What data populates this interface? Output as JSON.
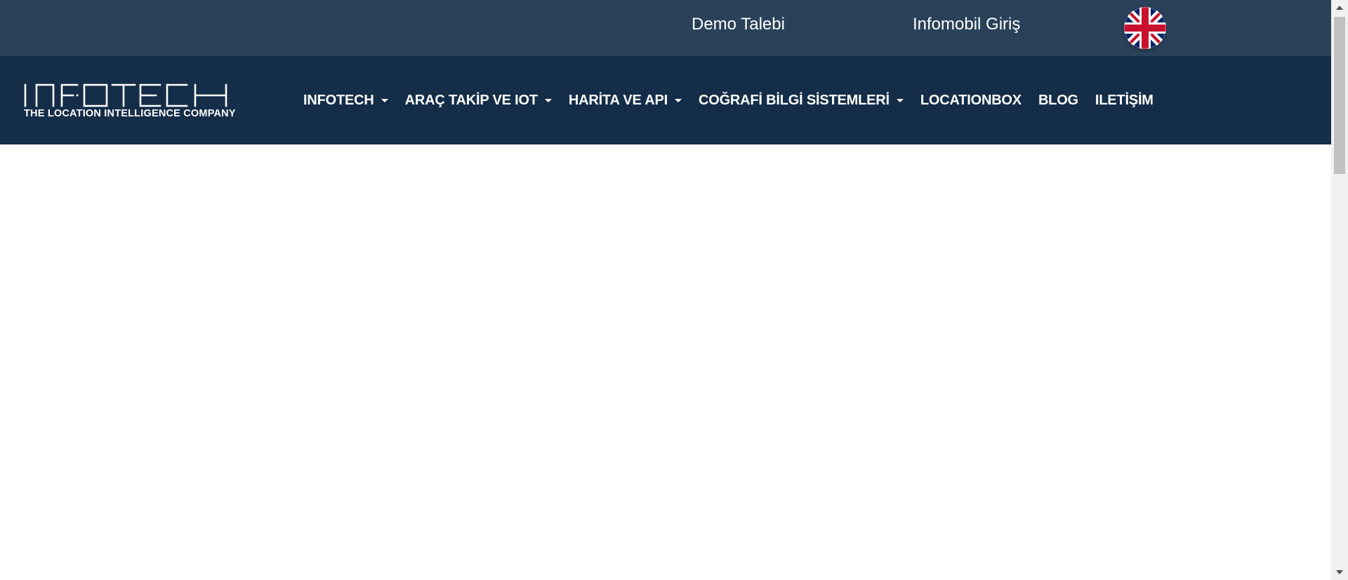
{
  "topbar": {
    "demo_label": "Demo Talebi",
    "infomobil_label": "Infomobil Giriş",
    "language_icon": "uk-flag-icon"
  },
  "logo": {
    "wordmark": "INFOTECH",
    "tagline": "THE  LOCATION INTELLIGENCE COMPANY"
  },
  "nav": {
    "items": [
      {
        "label": "INFOTECH",
        "dropdown": true
      },
      {
        "label": "ARAÇ TAKİP VE IOT",
        "dropdown": true
      },
      {
        "label": "HARİTA VE API",
        "dropdown": true
      },
      {
        "label": "COĞRAFİ BİLGİ SİSTEMLERİ",
        "dropdown": true
      },
      {
        "label": "LOCATIONBOX",
        "dropdown": false
      },
      {
        "label": "BLOG",
        "dropdown": false
      },
      {
        "label": "ILETİŞİM",
        "dropdown": false
      }
    ]
  },
  "colors": {
    "topbar_bg": "#294259",
    "navbar_bg": "#142d48",
    "text": "#ffffff"
  }
}
